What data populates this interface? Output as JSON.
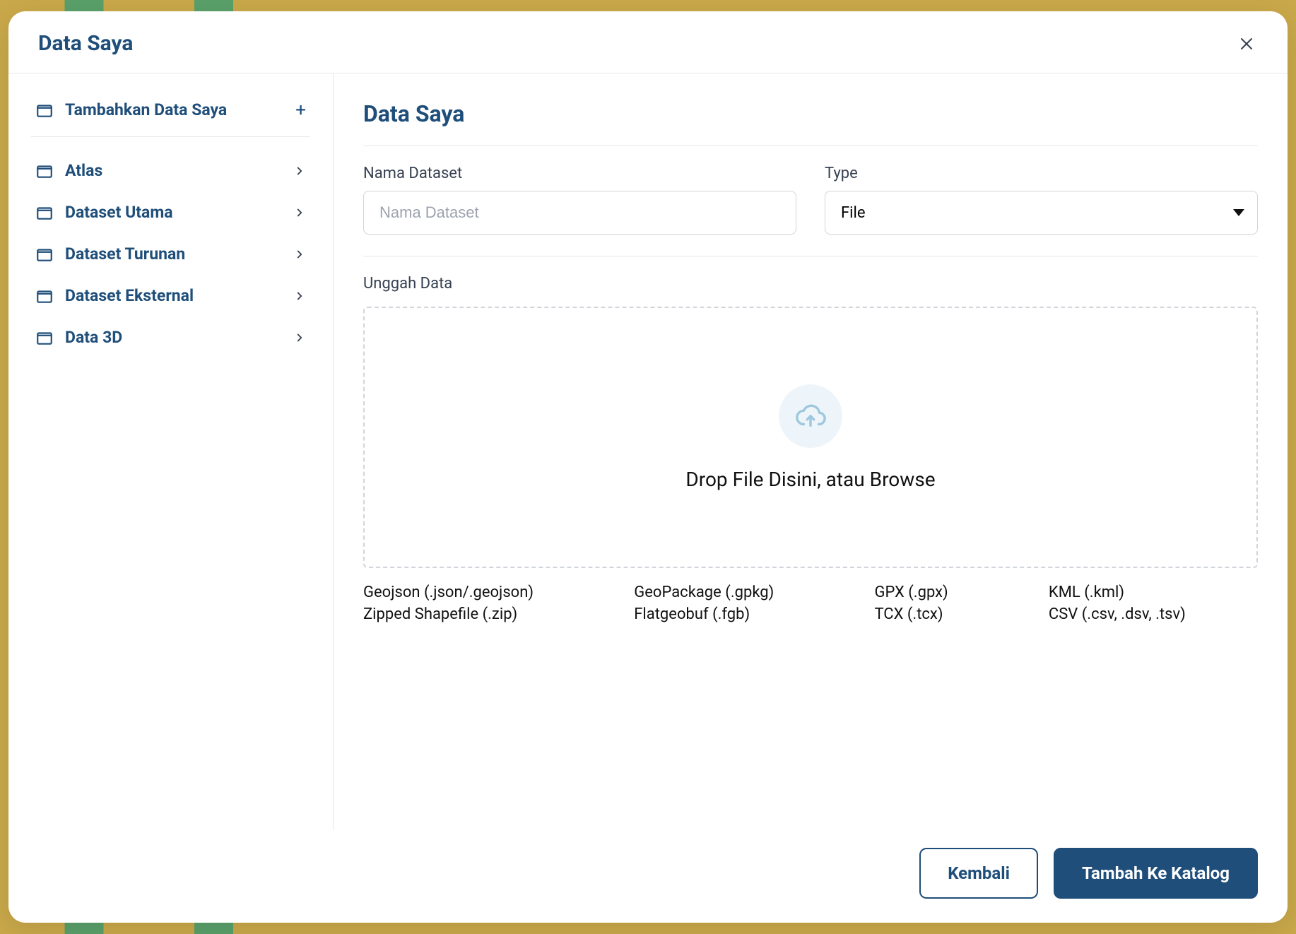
{
  "header": {
    "title": "Data Saya"
  },
  "sidebar": {
    "add_label": "Tambahkan Data Saya",
    "items": [
      {
        "label": "Atlas"
      },
      {
        "label": "Dataset Utama"
      },
      {
        "label": "Dataset Turunan"
      },
      {
        "label": "Dataset Eksternal"
      },
      {
        "label": "Data 3D"
      }
    ]
  },
  "main": {
    "title": "Data Saya",
    "name_label": "Nama Dataset",
    "name_placeholder": "Nama Dataset",
    "type_label": "Type",
    "type_value": "File",
    "upload_label": "Unggah Data",
    "drop_text": "Drop File Disini, atau Browse",
    "formats": [
      "Geojson (.json/.geojson)",
      "GeoPackage (.gpkg)",
      "GPX (.gpx)",
      "KML (.kml)",
      "Zipped Shapefile (.zip)",
      "Flatgeobuf (.fgb)",
      "TCX (.tcx)",
      "CSV (.csv, .dsv, .tsv)"
    ]
  },
  "footer": {
    "back": "Kembali",
    "add": "Tambah Ke Katalog"
  }
}
